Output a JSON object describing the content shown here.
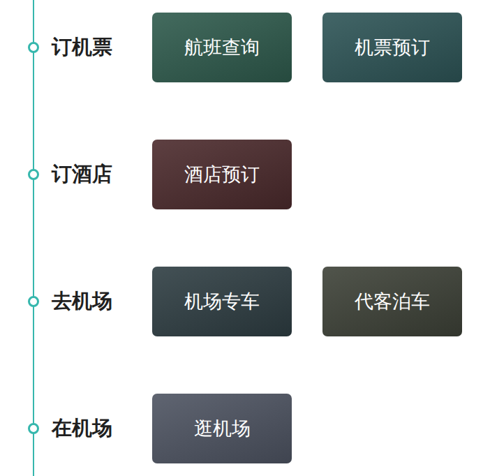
{
  "sections": [
    {
      "label": "订机票",
      "tiles": [
        {
          "label": "航班查询",
          "color": "#2e5a4c"
        },
        {
          "label": "机票预订",
          "color": "#2d5456"
        }
      ]
    },
    {
      "label": "订酒店",
      "tiles": [
        {
          "label": "酒店预订",
          "color": "#4b2a2c"
        }
      ]
    },
    {
      "label": "去机场",
      "tiles": [
        {
          "label": "机场专车",
          "color": "#2e3d42"
        },
        {
          "label": "代客泊车",
          "color": "#3d4137"
        }
      ]
    },
    {
      "label": "在机场",
      "tiles": [
        {
          "label": "逛机场",
          "color": "#4d5361"
        }
      ]
    }
  ]
}
